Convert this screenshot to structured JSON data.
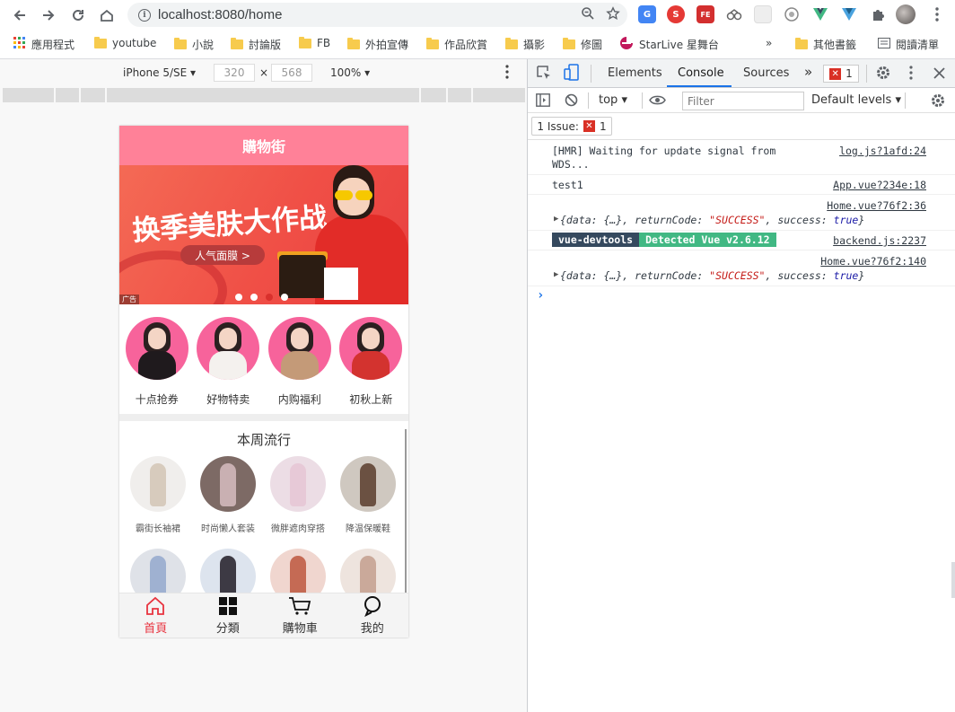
{
  "browser": {
    "url": "localhost:8080/home",
    "bookmarks": [
      "應用程式",
      "youtube",
      "小說",
      "討論版",
      "FB",
      "外拍宣傳",
      "作品欣賞",
      "攝影",
      "修圖",
      "StarLive 星舞台",
      "其他書籤",
      "閱讀清單"
    ],
    "overflow_glyph": "»",
    "extensions": [
      {
        "icon": "translate-icon",
        "color": "#4285f4",
        "glyph": "G"
      },
      {
        "icon": "s-extension-icon",
        "color": "#e53935",
        "glyph": "S"
      },
      {
        "icon": "fe-extension-icon",
        "color": "#d32f2f",
        "glyph": "FE"
      }
    ]
  },
  "device_toolbar": {
    "device": "iPhone 5/SE",
    "width": "320",
    "height": "568",
    "times": "×",
    "zoom": "100%"
  },
  "app": {
    "header_title": "購物街",
    "banner": {
      "headline": "换季美肤大作战",
      "pill": "人气面膜 >",
      "ad_label": "广告",
      "slide_count": 4,
      "active_slide": 3
    },
    "categories": [
      {
        "label": "十点抢券",
        "body_color": "#1f1a1d"
      },
      {
        "label": "好物特卖",
        "body_color": "#f4f1ee"
      },
      {
        "label": "内购福利",
        "body_color": "#c49a78"
      },
      {
        "label": "初秋上新",
        "body_color": "#d3332f"
      }
    ],
    "weekly_title": "本周流行",
    "weekly": [
      {
        "label": "霸街长袖裙",
        "bg": "#f0eeec",
        "fig": "#d7cbbd"
      },
      {
        "label": "时尚懒人套装",
        "bg": "#7d6a65",
        "fig": "#c9b0b2"
      },
      {
        "label": "微胖遮肉穿搭",
        "bg": "#ecdde5",
        "fig": "#e7c9d7"
      },
      {
        "label": "降温保暖鞋",
        "bg": "#cfc8c0",
        "fig": "#6b5142"
      },
      {
        "label": "",
        "bg": "#dfe2e8",
        "fig": "#9fb1d1"
      },
      {
        "label": "",
        "bg": "#dde4ee",
        "fig": "#3d3a44"
      },
      {
        "label": "",
        "bg": "#f0d6cf",
        "fig": "#c56a54"
      },
      {
        "label": "",
        "bg": "#eee4de",
        "fig": "#caa99a"
      }
    ],
    "tabs": [
      {
        "label": "首頁",
        "icon": "home-icon",
        "active": true
      },
      {
        "label": "分類",
        "icon": "grid-icon",
        "active": false
      },
      {
        "label": "購物車",
        "icon": "cart-icon",
        "active": false
      },
      {
        "label": "我的",
        "icon": "profile-icon",
        "active": false
      }
    ]
  },
  "devtools": {
    "tabs": [
      "Elements",
      "Console",
      "Sources"
    ],
    "active_tab": "Console",
    "overflow_glyph": "»",
    "error_count": "1",
    "context": "top",
    "filter_placeholder": "Filter",
    "levels": "Default levels",
    "issues_label": "1 Issue:",
    "issues_count": "1",
    "logs": [
      {
        "message": "[HMR] Waiting for update signal from",
        "message2": "WDS...",
        "source": "log.js?1afd:24"
      },
      {
        "message": "test1",
        "source": "App.vue?234e:18"
      },
      {
        "source": "Home.vue?76f2:36",
        "object_prefix": "{data: {…}, returnCode: ",
        "string_value": "\"SUCCESS\"",
        "object_mid": ", success: ",
        "bool_value": "true",
        "object_suffix": "}"
      },
      {
        "badge_left": "vue-devtools",
        "badge_right": "Detected Vue v2.6.12",
        "source": "backend.js:2237"
      },
      {
        "source": "Home.vue?76f2:140",
        "object_prefix": "{data: {…}, returnCode: ",
        "string_value": "\"SUCCESS\"",
        "object_mid": ", success: ",
        "bool_value": "true",
        "object_suffix": "}"
      }
    ],
    "prompt": "›"
  }
}
